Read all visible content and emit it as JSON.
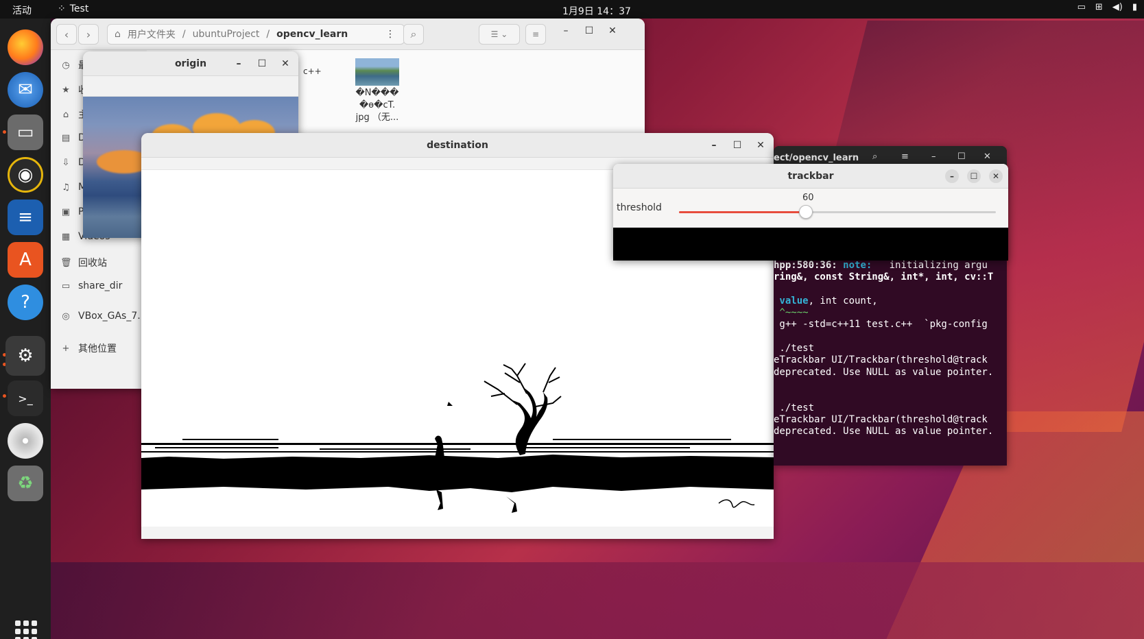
{
  "topbar": {
    "activities": "活动",
    "app_name": "Test",
    "clock": "1月9日 14：37"
  },
  "dock": {
    "items": [
      "firefox-icon",
      "thunderbird-icon",
      "files-icon",
      "rhythmbox-icon",
      "libreoffice-writer-icon",
      "app-center-icon",
      "help-icon",
      "settings-icon",
      "terminal-icon",
      "disc-icon",
      "trash-icon"
    ]
  },
  "file_manager": {
    "path": [
      "用户文件夹",
      "ubuntuProject",
      "opencv_learn"
    ],
    "sidebar": [
      "最",
      "收",
      "主",
      "D",
      "D",
      "M",
      "Pi",
      "Videos",
      "回收站",
      "share_dir",
      "VBox_GAs_7....",
      "其他位置"
    ],
    "file_cpp_label": "c++",
    "file_image_label": [
      "�N���",
      "�ө�cT.",
      "jpg （无..."
    ]
  },
  "origin_window": {
    "title": "origin"
  },
  "destination_window": {
    "title": "destination"
  },
  "trackbar_window": {
    "title": "trackbar",
    "label": "threshold",
    "value": "60",
    "position": 0.4
  },
  "terminal": {
    "title_fragment": "ect/opencv_learn",
    "lines": [
      {
        "parts": [
          {
            "t": "hpp:580:36: ",
            "c": "b"
          },
          {
            "t": "note:",
            "c": "cy"
          },
          {
            "t": "   initializing argu",
            "c": ""
          }
        ]
      },
      {
        "parts": [
          {
            "t": "ring&, const String&, int*, int, cv::T",
            "c": "b"
          }
        ]
      },
      {
        "parts": [
          {
            "t": "",
            "c": ""
          }
        ]
      },
      {
        "parts": [
          {
            "t": " value",
            "c": "cy"
          },
          {
            "t": ", int count,",
            "c": ""
          }
        ]
      },
      {
        "parts": [
          {
            "t": " ^~~~~",
            "c": "gr"
          }
        ]
      },
      {
        "parts": [
          {
            "t": " g++ -std=c++11 test.c++  `pkg-config",
            "c": ""
          }
        ]
      },
      {
        "parts": [
          {
            "t": "",
            "c": ""
          }
        ]
      },
      {
        "parts": [
          {
            "t": " ./test",
            "c": ""
          }
        ]
      },
      {
        "parts": [
          {
            "t": "eTrackbar UI/Trackbar(threshold@track",
            "c": ""
          }
        ]
      },
      {
        "parts": [
          {
            "t": "deprecated. Use NULL as value pointer.",
            "c": ""
          }
        ]
      },
      {
        "parts": [
          {
            "t": "",
            "c": ""
          }
        ]
      },
      {
        "parts": [
          {
            "t": "",
            "c": ""
          }
        ]
      },
      {
        "parts": [
          {
            "t": " ./test",
            "c": ""
          }
        ]
      },
      {
        "parts": [
          {
            "t": "eTrackbar UI/Trackbar(threshold@track",
            "c": ""
          }
        ]
      },
      {
        "parts": [
          {
            "t": "deprecated. Use NULL as value pointer.",
            "c": ""
          }
        ]
      }
    ]
  }
}
